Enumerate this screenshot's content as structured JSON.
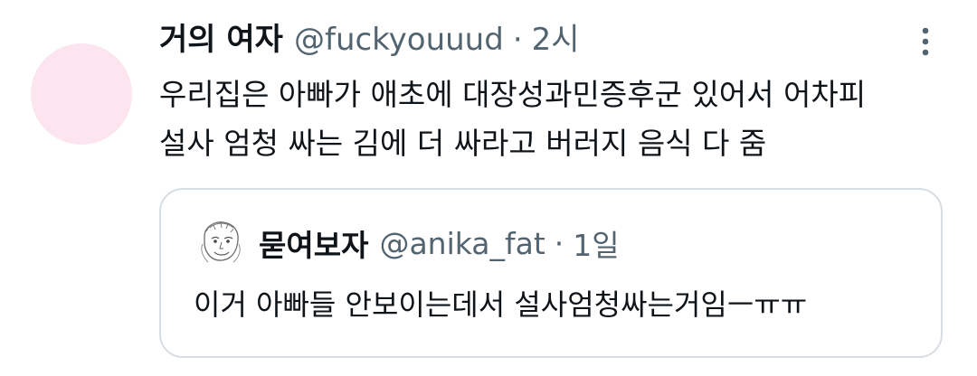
{
  "tweet": {
    "display_name": "거의 여자",
    "handle": "@fuckyouuud",
    "separator": "·",
    "time": "2시",
    "text_lines": [
      "우리집은 아빠가 애초에 대장성과민증후군 있어서 어차피",
      "설사 엄청 싸는 김에 더 싸라고 버러지 음식 다 줌"
    ],
    "avatar_color": "#fce5ee",
    "more_icon": "more-vertical-icon"
  },
  "quote": {
    "display_name": "묻여보자",
    "handle": "@anika_fat",
    "separator": "·",
    "time": "1일",
    "text": "이거 아빠들 안보이는데서 설사엄청싸는거임ㅡㅠㅠ",
    "avatar_icon": "sketch-face-avatar",
    "border_color": "#d7dde2"
  },
  "colors": {
    "text_primary": "#0f1419",
    "text_secondary": "#536471"
  }
}
